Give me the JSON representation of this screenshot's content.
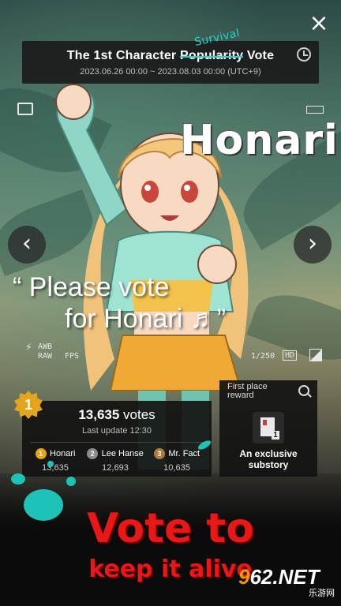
{
  "header": {
    "title_prefix": "The 1st Character ",
    "title_struck": "Popularity",
    "title_suffix": " Vote",
    "title_overlay": "Survival",
    "period": "2023.06.26 00:00 ~ 2023.08.03 00:00 (UTC+9)",
    "history_icon": "history-icon"
  },
  "close_icon": "×",
  "character": {
    "name": "Honari",
    "quote_line1": "“ Please vote",
    "quote_line2": "for Honari ♬”"
  },
  "nav": {
    "prev_glyph": "‹",
    "next_glyph": "›"
  },
  "hud": {
    "awb": "AWB",
    "raw": "RAW",
    "fps": "FPS",
    "shutter": "1/250",
    "hd": "HD"
  },
  "ranking": {
    "current_rank": "1",
    "votes_value": "13,635",
    "votes_label": "votes",
    "last_update": "Last update 12:30",
    "entries": [
      {
        "rank": "1",
        "name": "Honari",
        "votes": "13,635",
        "color": "#e3a51d"
      },
      {
        "rank": "2",
        "name": "Lee Hanse",
        "votes": "12,693",
        "color": "#8c8c8c"
      },
      {
        "rank": "3",
        "name": "Mr. Fact",
        "votes": "10,635",
        "color": "#b07a3c"
      }
    ]
  },
  "reward": {
    "label": "First place reward",
    "description": "An exclusive substory",
    "doc_count": "1"
  },
  "slogan": {
    "line1": "Vote to",
    "line2": "keep it alive"
  },
  "watermark": {
    "brand_a": "9",
    "brand_b": "62",
    "brand_c": ".NET",
    "sub": "乐游网"
  },
  "colors": {
    "accent_teal": "#1dc3b9",
    "slogan_red": "#e81818",
    "gold": "#e3a51d"
  }
}
